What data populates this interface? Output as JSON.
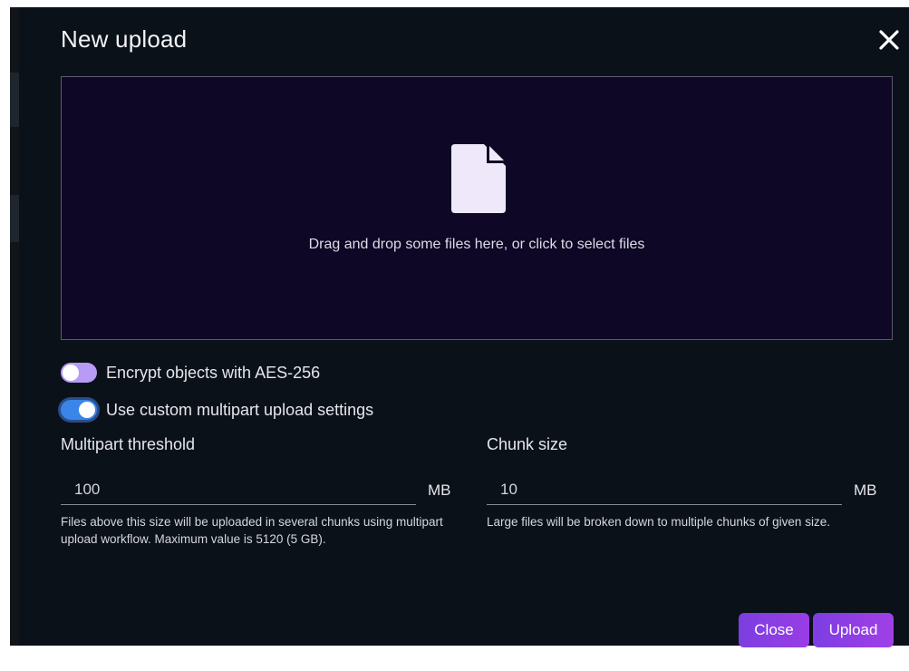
{
  "dialog": {
    "title": "New upload",
    "close_icon": "close-icon"
  },
  "dropzone": {
    "icon": "file-icon",
    "text": "Drag and drop some files here, or click to select files"
  },
  "options": {
    "encrypt": {
      "label": "Encrypt objects with AES-256",
      "checked": false
    },
    "multipart": {
      "label": "Use custom multipart upload settings",
      "checked": true
    }
  },
  "multipart": {
    "threshold": {
      "label": "Multipart threshold",
      "value": "100",
      "unit": "MB",
      "help": "Files above this size will be uploaded in several chunks using multipart upload workflow. Maximum value is 5120 (5 GB)."
    },
    "chunk": {
      "label": "Chunk size",
      "value": "10",
      "unit": "MB",
      "help": "Large files will be broken down to multiple chunks of given size."
    }
  },
  "footer": {
    "close_label": "Close",
    "upload_label": "Upload"
  },
  "colors": {
    "modal_bg": "#0a1119",
    "dropzone_bg": "#0e0726",
    "toggle_on": "#3a86e8",
    "toggle_off": "#b79bf5",
    "button_accent": "#8a3ee4"
  }
}
